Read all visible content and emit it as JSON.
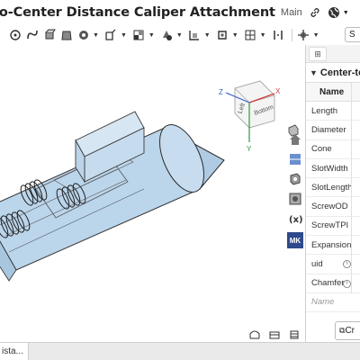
{
  "document": {
    "title": "to-Center Distance Caliper Attachment",
    "branch": "Main"
  },
  "toolbar": {
    "sketch_label": "S"
  },
  "viewcube": {
    "faces": [
      "Left",
      "Bottom"
    ],
    "axes": [
      "Z",
      "X",
      "Y"
    ]
  },
  "side_strip": {
    "mk_label": "MK"
  },
  "panel": {
    "tab_label": "⊞",
    "title": "Center-to-",
    "column_name": "Name",
    "rows": [
      {
        "name": "Length",
        "info": false
      },
      {
        "name": "Diameter",
        "info": false
      },
      {
        "name": "Cone",
        "info": false
      },
      {
        "name": "SlotWidth",
        "info": false
      },
      {
        "name": "SlotLength",
        "info": false
      },
      {
        "name": "ScrewOD",
        "info": false
      },
      {
        "name": "ScrewTPI",
        "info": false
      },
      {
        "name": "Expansion",
        "info": false
      },
      {
        "name": "uid",
        "info": true
      },
      {
        "name": "Chamfer",
        "info": true
      }
    ],
    "add_placeholder": "Name",
    "create_label": "Cr"
  },
  "bottom": {
    "tab_label": "ista..."
  },
  "colors": {
    "model_fill": "#b8d3ea",
    "model_edge": "#2b2b2b",
    "accent": "#2e4a8c"
  }
}
